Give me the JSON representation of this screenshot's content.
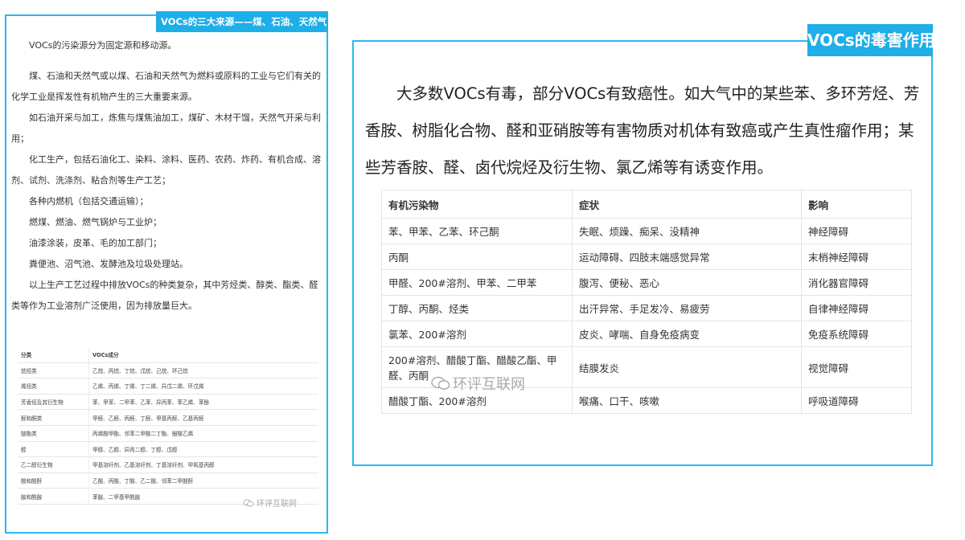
{
  "left": {
    "tag": "VOCs的三大来源——煤、石油、天然气",
    "paragraphs": [
      "VOCs的污染源分为固定源和移动源。",
      "煤、石油和天然气或以煤、石油和天然气为燃料或原料的工业与它们有关的化学工业是挥发性有机物产生的三大重要来源。",
      "如石油开采与加工，炼焦与煤焦油加工，煤矿、木材干馏，天然气开采与利用；",
      "化工生产，包括石油化工、染料、涂料、医药、农药、炸药、有机合成、溶剂、试剂、洗涤剂、粘合剂等生产工艺；",
      "各种内燃机（包括交通运输）；",
      "燃煤、燃油、燃气锅炉与工业炉；",
      "油漆涂装，皮革、毛的加工部门；",
      "粪便池、沼气池、发酵池及垃圾处理站。",
      "以上生产工艺过程中排放VOCs的种类复杂，其中芳烃类、醇类、酯类、醛类等作为工业溶剂广泛使用，因为排放量巨大。"
    ],
    "table": {
      "headers": [
        "分类",
        "VOCs成分"
      ],
      "rows": [
        [
          "烷烃类",
          "乙烷、丙烷、丁烷、戊烷、己烷、环己烷"
        ],
        [
          "烯烃类",
          "乙烯、丙烯、丁烯、丁二烯、异戊二烯、环戊烯"
        ],
        [
          "芳香烃及其衍生物",
          "苯、甲苯、二甲苯、乙苯、异丙苯、苯乙烯、苯酚"
        ],
        [
          "醛和酮类",
          "甲醛、乙醛、丙醛、丁醛、甲基丙醛、乙基丙醛"
        ],
        [
          "醚酯类",
          "丙烯酸甲酯、邻苯二甲酸二丁酯、醋酸乙烯"
        ],
        [
          "醇",
          "甲醇、乙醇、异丙二醇、丁醇、戊醇"
        ],
        [
          "乙二醇衍生物",
          "甲基溶纤剂、乙基溶纤剂、丁基溶纤剂、甲氧基丙醇"
        ],
        [
          "酸和酸酐",
          "乙酸、丙酸、丁酸、乙二酸、邻苯二甲酸酐"
        ],
        [
          "胺和酰胺",
          "苯胺、二甲基甲酰胺"
        ]
      ]
    },
    "watermark": "环评互联网"
  },
  "right": {
    "tag": "VOCs的毒害作用",
    "paragraph": "大多数VOCs有毒，部分VOCs有致癌性。如大气中的某些苯、多环芳烃、芳香胺、树脂化合物、醛和亚硝胺等有害物质对机体有致癌或产生真性瘤作用；某些芳香胺、醛、卤代烷烃及衍生物、氯乙烯等有诱变作用。",
    "table": {
      "headers": [
        "有机污染物",
        "症状",
        "影响"
      ],
      "rows": [
        [
          "苯、甲苯、乙苯、环己酮",
          "失眠、烦躁、痴呆、没精神",
          "神经障碍"
        ],
        [
          "丙酮",
          "运动障碍、四肢末端感觉异常",
          "末梢神经障碍"
        ],
        [
          "甲醛、200#溶剂、甲苯、二甲苯",
          "腹泻、便秘、恶心",
          "消化器官障碍"
        ],
        [
          "丁醇、丙酮、烃类",
          "出汗异常、手足发冷、易疲劳",
          "自律神经障碍"
        ],
        [
          "氯苯、200#溶剂",
          "皮炎、哮喘、自身免疫病变",
          "免疫系统障碍"
        ],
        [
          "200#溶剂、醋酸丁酯、醋酸乙酯、甲醛、丙酮",
          "结膜发炎",
          "视觉障碍"
        ],
        [
          "醋酸丁酯、200#溶剂",
          "喉痛、口干、咳嗽",
          "呼吸道障碍"
        ]
      ]
    },
    "watermark": "环评互联网"
  },
  "colors": {
    "accent": "#1eaee8",
    "border": "#29b8ee"
  },
  "icons": {
    "watermark": "wechat-icon"
  }
}
